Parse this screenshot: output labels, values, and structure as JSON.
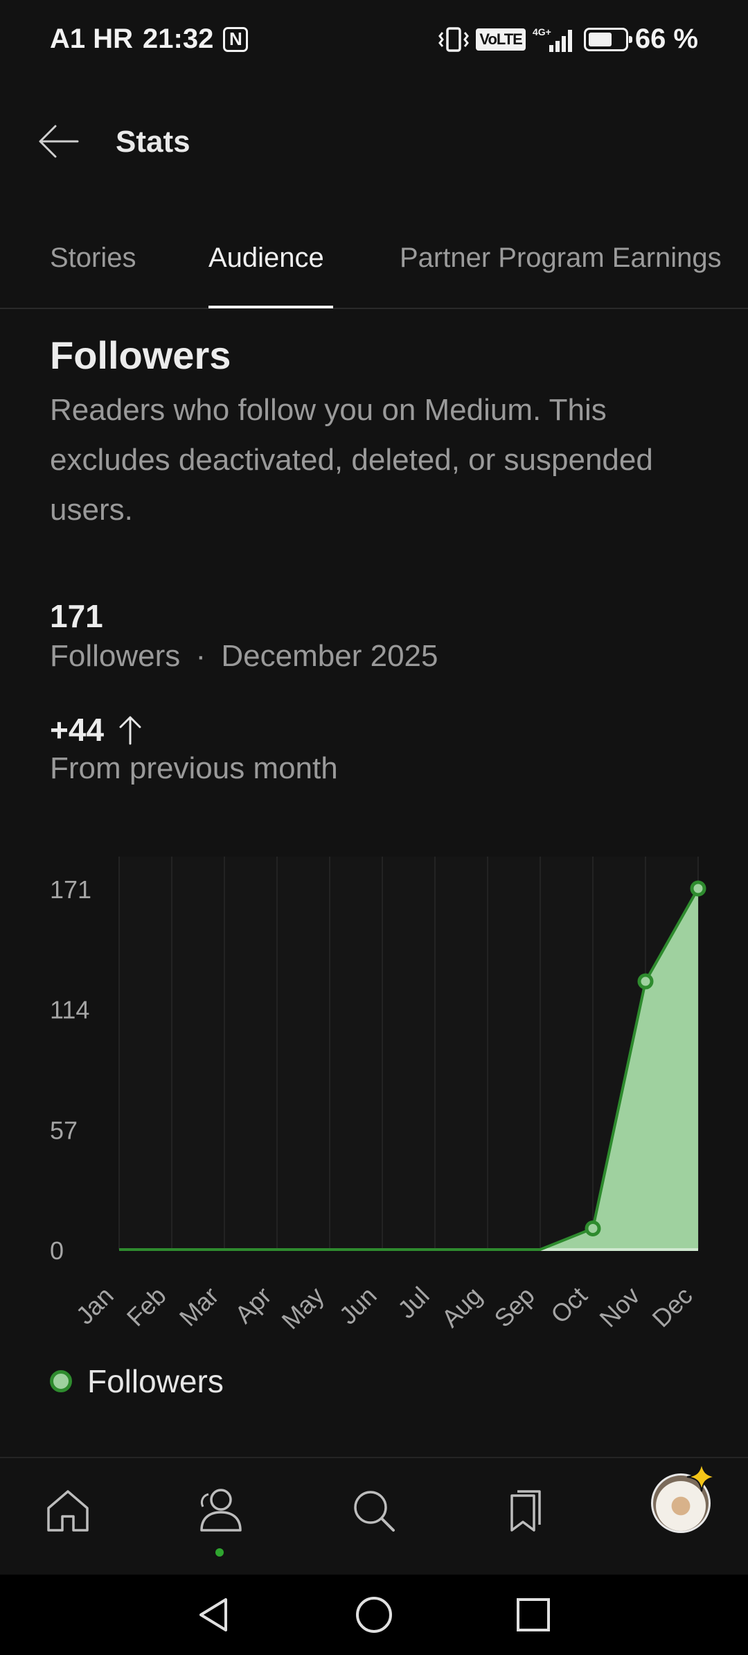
{
  "status_bar": {
    "carrier": "A1 HR",
    "time": "21:32",
    "nfc_glyph": "N",
    "volte": "VoLTE",
    "network": "4G+",
    "battery_percent": "66 %",
    "battery_level": 0.66
  },
  "header": {
    "title": "Stats"
  },
  "tabs": [
    {
      "label": "Stories"
    },
    {
      "label": "Audience"
    },
    {
      "label": "Partner Program Earnings"
    }
  ],
  "active_tab": "Audience",
  "followers": {
    "title": "Followers",
    "description": "Readers who follow you on Medium. This excludes deactivated, deleted, or suspended users.",
    "count": "171",
    "count_label": "Followers",
    "separator": "·",
    "period": "December 2025",
    "delta": "+44",
    "delta_label": "From previous month"
  },
  "chart_data": {
    "type": "area",
    "categories": [
      "Jan",
      "Feb",
      "Mar",
      "Apr",
      "May",
      "Jun",
      "Jul",
      "Aug",
      "Sep",
      "Oct",
      "Nov",
      "Dec"
    ],
    "series": [
      {
        "name": "Followers",
        "values": [
          0,
          0,
          0,
          0,
          0,
          0,
          0,
          0,
          0,
          10,
          127,
          171
        ]
      }
    ],
    "marked_points": [
      "Oct",
      "Nov",
      "Dec"
    ],
    "y_ticks": [
      "0",
      "57",
      "114",
      "171"
    ],
    "ylim": [
      0,
      171
    ],
    "grid": "vertical",
    "legend": "bottom-left",
    "colors": {
      "line": "#2e8b2e",
      "fill": "#9fd19f",
      "baseline": "#cfe8cf"
    }
  },
  "legend_label": "Followers",
  "nav": {
    "items": [
      "home-icon",
      "profile-icon",
      "search-icon",
      "bookmarks-icon",
      "avatar"
    ],
    "active": "profile-icon"
  }
}
